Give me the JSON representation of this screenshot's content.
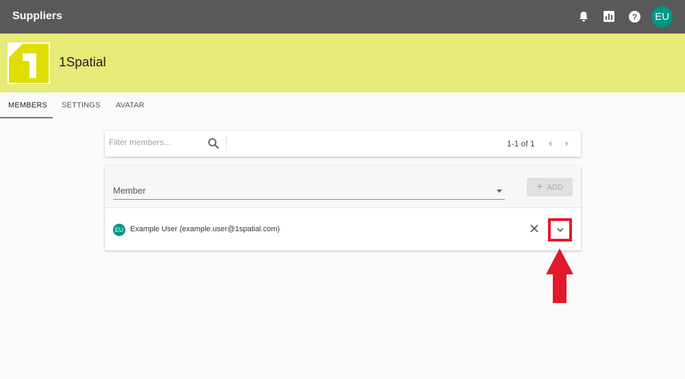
{
  "app": {
    "title": "Suppliers",
    "user_initials": "EU",
    "icons": [
      "bell-icon",
      "chart-icon",
      "help-icon"
    ]
  },
  "org": {
    "name": "1Spatial",
    "logo_text": "1",
    "banner_color": "#e6ea76"
  },
  "tabs": [
    {
      "label": "MEMBERS",
      "active": true
    },
    {
      "label": "SETTINGS",
      "active": false
    },
    {
      "label": "AVATAR",
      "active": false
    }
  ],
  "filter": {
    "placeholder": "Filter members...",
    "value": "",
    "pagination": "1-1 of 1"
  },
  "add_member": {
    "select_label": "Member",
    "add_label": "ADD"
  },
  "members": [
    {
      "initials": "EU",
      "name": "Example User (example.user@1spatial.com)"
    }
  ],
  "colors": {
    "topbar": "#595959",
    "accent": "#009688",
    "highlight": "#e11a2b"
  }
}
